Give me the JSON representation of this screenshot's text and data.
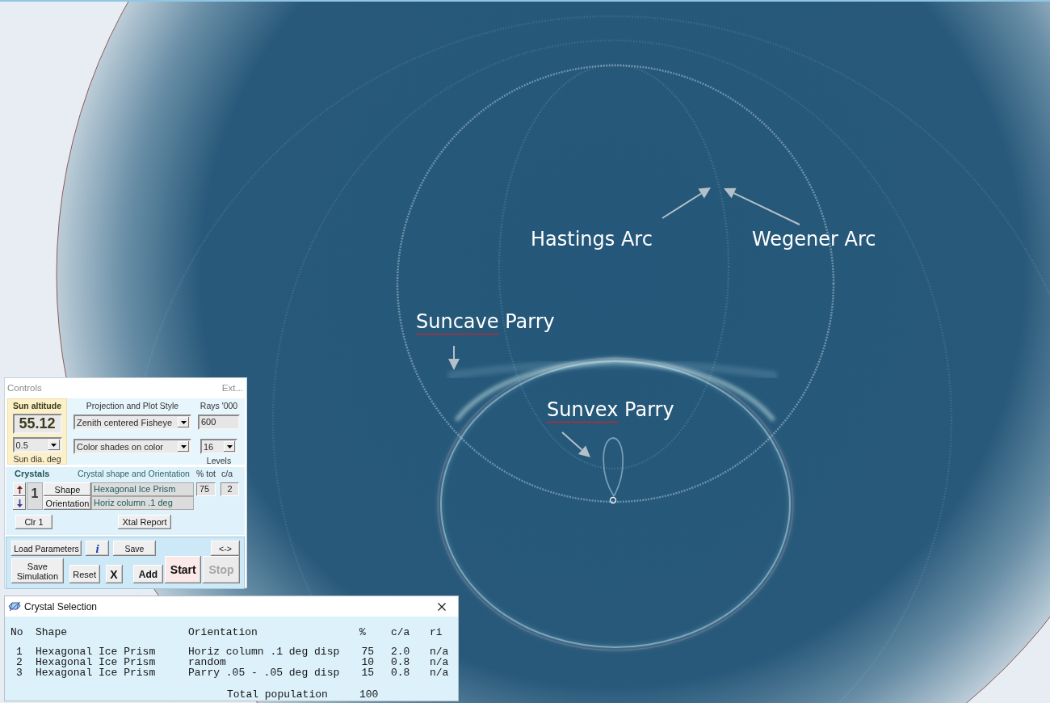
{
  "annotations": [
    {
      "words": [
        {
          "text": "Hastings",
          "spell_flag": false
        },
        {
          "text": "Arc",
          "spell_flag": false
        }
      ]
    },
    {
      "words": [
        {
          "text": "Wegener",
          "spell_flag": false
        },
        {
          "text": "Arc",
          "spell_flag": false
        }
      ]
    },
    {
      "words": [
        {
          "text": "Suncave",
          "spell_flag": true
        },
        {
          "text": "Parry",
          "spell_flag": false
        }
      ]
    },
    {
      "words": [
        {
          "text": "Sunvex",
          "spell_flag": true
        },
        {
          "text": "Parry",
          "spell_flag": false
        }
      ]
    }
  ],
  "controls": {
    "title": "Controls",
    "ext": "Ext...",
    "sun": {
      "label": "Sun altitude",
      "altitude": "55.12",
      "diameter": "0.5",
      "diameter_label": "Sun dia. deg"
    },
    "plot": {
      "label": "Projection and Plot Style",
      "projection": "Zenith centered Fisheye",
      "style": "Color shades on color"
    },
    "rays": {
      "label": "Rays '000",
      "value": "600",
      "levels": "16",
      "levels_label": "Levels"
    },
    "crystals": {
      "label": "Crystals",
      "shape_label": "Crystal shape and Orientation",
      "percent_label": "% tot",
      "ratio_label": "c/a",
      "number": "1",
      "shape_button": "Shape",
      "orientation_button": "Orientation",
      "shape": "Hexagonal Ice Prism",
      "orientation": "Horiz column .1 deg",
      "percent": "75",
      "ratio": "2",
      "clear_button": "Clr 1",
      "report_button": "Xtal Report"
    },
    "button_rows": [
      {
        "buttons": [
          {
            "label": "Load Parameters",
            "kind": "plain",
            "disabled": false
          },
          {
            "label": "i",
            "kind": "info",
            "disabled": false
          },
          {
            "label": "Save",
            "kind": "plain",
            "disabled": false
          },
          {
            "label": "<->",
            "kind": "plain",
            "disabled": false
          }
        ]
      },
      {
        "buttons": [
          {
            "label": "Save Simulation",
            "kind": "plain",
            "disabled": false
          },
          {
            "label": "Reset",
            "kind": "plain",
            "disabled": false
          },
          {
            "label": "X",
            "kind": "symbol",
            "disabled": false
          },
          {
            "label": "Add",
            "kind": "bold",
            "disabled": false
          },
          {
            "label": "Start",
            "kind": "large",
            "disabled": false
          },
          {
            "label": "Stop",
            "kind": "large",
            "disabled": true
          }
        ]
      }
    ]
  },
  "crystal_selection": {
    "title": "Crystal Selection",
    "columns": [
      "No",
      "Shape",
      "Orientation",
      "%",
      "c/a",
      "ri"
    ],
    "rows": [
      {
        "no": "1",
        "shape": "Hexagonal Ice Prism",
        "orientation": "Horiz column .1 deg disp",
        "percent": "75",
        "ratio": "2.0",
        "ri": "n/a"
      },
      {
        "no": "2",
        "shape": "Hexagonal Ice Prism",
        "orientation": "random",
        "percent": "10",
        "ratio": "0.8",
        "ri": "n/a"
      },
      {
        "no": "3",
        "shape": "Hexagonal Ice Prism",
        "orientation": "Parry .05 - .05 deg disp",
        "percent": "15",
        "ratio": "0.8",
        "ri": "n/a"
      }
    ],
    "total_label": "Total population",
    "total": "100"
  }
}
